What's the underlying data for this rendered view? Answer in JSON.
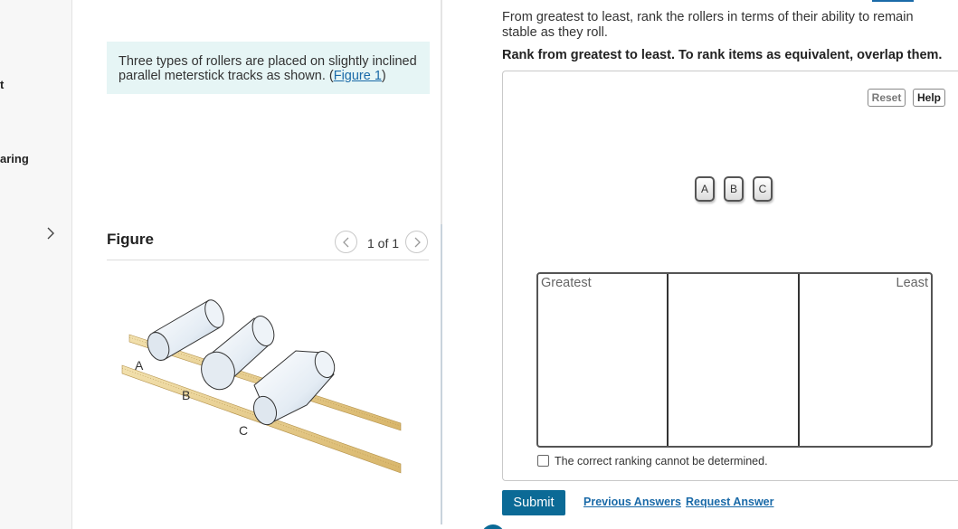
{
  "sidebar": {
    "items": [
      {
        "label": "t"
      },
      {
        "label": "aring"
      }
    ]
  },
  "problem": {
    "intro_text": "Three types of rollers are placed on slightly inclined parallel meterstick tracks as shown. (",
    "figure_link": "Figure 1",
    "intro_close": ")"
  },
  "figure": {
    "heading": "Figure",
    "pager": "1 of 1",
    "labels": {
      "a": "A",
      "b": "B",
      "c": "C"
    }
  },
  "question": {
    "prompt": "From greatest to least, rank the rollers in terms of their ability to remain stable as they roll.",
    "instruction": "Rank from greatest to least. To rank items as equivalent, overlap them."
  },
  "ranking": {
    "reset_label": "Reset",
    "help_label": "Help",
    "items": [
      "A",
      "B",
      "C"
    ],
    "greatest_label": "Greatest",
    "least_label": "Least",
    "cannot_determine": "The correct ranking cannot be determined."
  },
  "actions": {
    "submit": "Submit",
    "previous_answers": "Previous Answers",
    "request_answer": "Request Answer"
  },
  "colors": {
    "accent": "#0b6a96",
    "link": "#1a6aa8",
    "intro_bg": "#e6f5f5"
  }
}
